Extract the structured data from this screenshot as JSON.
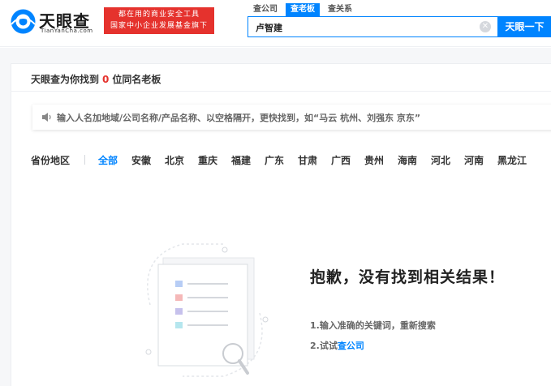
{
  "header": {
    "logo_text": "天眼查",
    "logo_sub": "TianYanCha.com",
    "slogan_line1": "都在用的商业安全工具",
    "slogan_line2": "国家中小企业发展基金旗下",
    "search_tabs": [
      {
        "label": "查公司",
        "active": false
      },
      {
        "label": "查老板",
        "active": true
      },
      {
        "label": "查关系",
        "active": false
      }
    ],
    "search_value": "卢智建",
    "search_button": "天眼一下"
  },
  "result": {
    "prefix": "天眼查为你找到",
    "count": "0",
    "suffix": "位同名老板"
  },
  "hint": {
    "text": "输入人名加地域/公司名称/产品名称、以空格隔开，更快找到，如“马云 杭州、刘强东 京东”"
  },
  "regions": {
    "label": "省份地区",
    "items": [
      {
        "label": "全部",
        "active": true
      },
      {
        "label": "安徽",
        "active": false
      },
      {
        "label": "北京",
        "active": false
      },
      {
        "label": "重庆",
        "active": false
      },
      {
        "label": "福建",
        "active": false
      },
      {
        "label": "广东",
        "active": false
      },
      {
        "label": "甘肃",
        "active": false
      },
      {
        "label": "广西",
        "active": false
      },
      {
        "label": "贵州",
        "active": false
      },
      {
        "label": "海南",
        "active": false
      },
      {
        "label": "河北",
        "active": false
      },
      {
        "label": "河南",
        "active": false
      },
      {
        "label": "黑龙江",
        "active": false
      }
    ]
  },
  "empty": {
    "title": "抱歉，没有找到相关结果！",
    "tip1": "1.输入准确的关键词，重新搜索",
    "tip2_prefix": "2.试试",
    "tip2_link": "查公司"
  },
  "colors": {
    "brand_blue": "#0084ff",
    "accent_red": "#e5322d"
  }
}
